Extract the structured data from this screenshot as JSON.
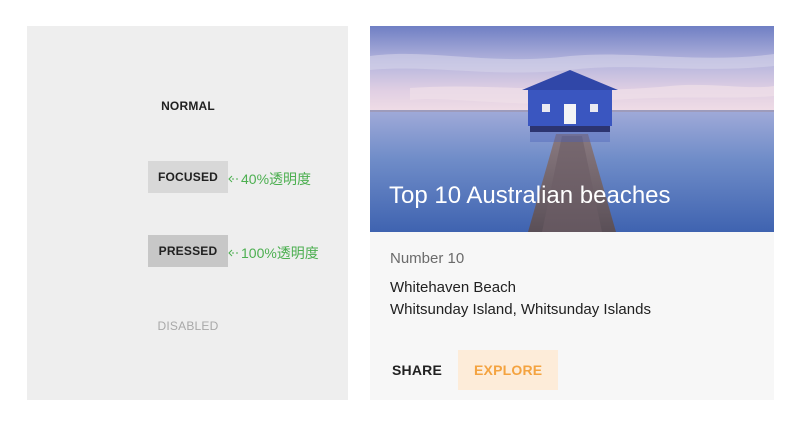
{
  "states": {
    "normal_label": "NORMAL",
    "focused_label": "FOCUSED",
    "pressed_label": "PRESSED",
    "disabled_label": "DISABLED",
    "focused_note": "40%透明度",
    "pressed_note": "100%透明度"
  },
  "card": {
    "title": "Top 10 Australian beaches",
    "subhead": "Number 10",
    "line1": "Whitehaven Beach",
    "line2": "Whitsunday Island, Whitsunday Islands",
    "share_label": "SHARE",
    "explore_label": "EXPLORE"
  },
  "colors": {
    "accent": "#f4a340",
    "annotation": "#4caf50",
    "panel_bg": "#eeeeee"
  }
}
